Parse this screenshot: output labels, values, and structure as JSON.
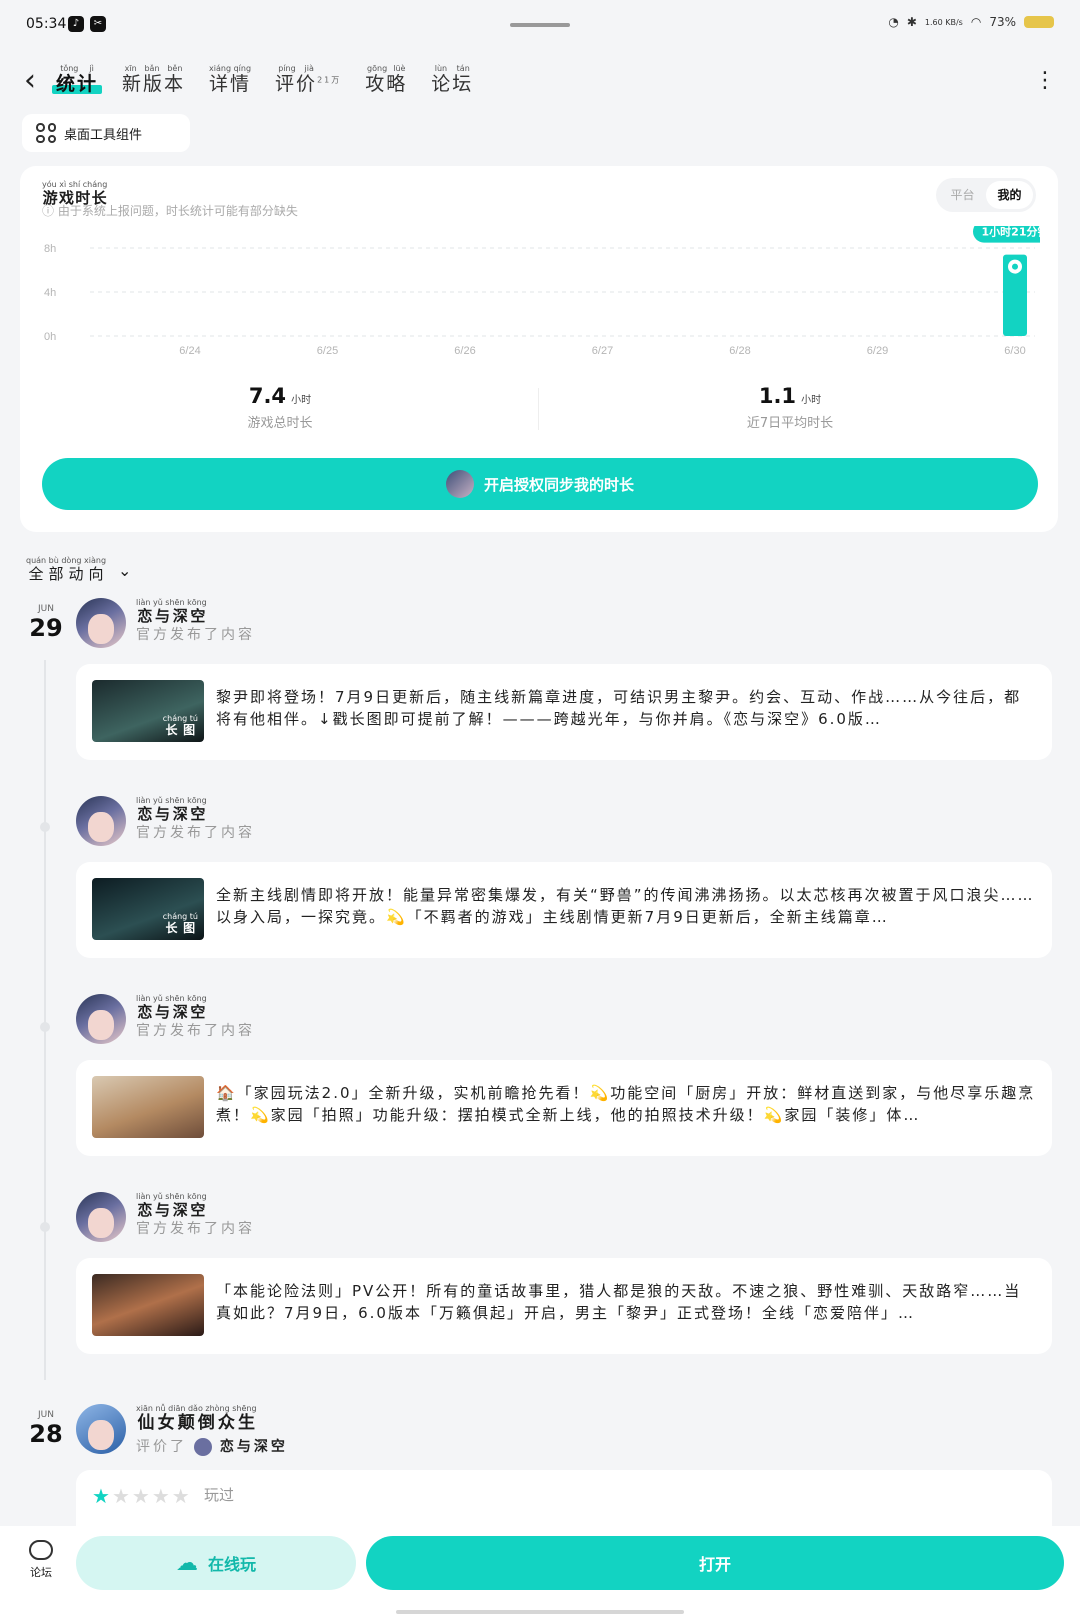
{
  "status": {
    "time": "05:34",
    "battery": "73%",
    "net_speed": "1.60 KB/s"
  },
  "nav": {
    "tabs": [
      {
        "label": "统计",
        "py": [
          "tǒng",
          "jì"
        ],
        "active": true
      },
      {
        "label": "新版本",
        "py": [
          "xīn",
          "bǎn",
          "běn"
        ]
      },
      {
        "label": "详情",
        "py": [
          "xiáng",
          "qíng"
        ]
      },
      {
        "label": "评价",
        "py": [
          "píng",
          "jià"
        ],
        "badge": "21万"
      },
      {
        "label": "攻略",
        "py": [
          "gōng",
          "lüè"
        ]
      },
      {
        "label": "论坛",
        "py": [
          "lùn",
          "tán"
        ]
      }
    ]
  },
  "widget_btn": "桌面工具组件",
  "stats": {
    "title": "游戏时长",
    "note": "由于系统上报问题，时长统计可能有部分缺失",
    "segments": [
      "平台",
      "我的"
    ],
    "active_segment": "我的",
    "tooltip": "1小时21分钟",
    "total_value": "7.4",
    "total_unit": "小时",
    "total_label": "游戏总时长",
    "avg_value": "1.1",
    "avg_unit": "小时",
    "avg_label": "近7日平均时长",
    "sync_btn": "开启授权同步我的时长"
  },
  "chart_data": {
    "type": "bar",
    "categories": [
      "6/24",
      "6/25",
      "6/26",
      "6/27",
      "6/28",
      "6/29",
      "6/30"
    ],
    "values": [
      0,
      0,
      0,
      0,
      0,
      0,
      7.4
    ],
    "yticks": [
      "8h",
      "4h",
      "0h"
    ],
    "ylim": [
      0,
      8
    ],
    "color": "#12d3c2"
  },
  "filter_label": "全部动向",
  "feed": [
    {
      "month": "JUN",
      "day": "29",
      "author": "恋与深空",
      "desc": "官方发布了内容",
      "thumb_tag": "长图",
      "text": "黎尹即将登场！7月9日更新后，随主线新篇章进度，可结识男主黎尹。约会、互动、作战……从今往后，都将有他相伴。↓戳长图即可提前了解！———跨越光年，与你并肩。《恋与深空》6.0版…"
    },
    {
      "author": "恋与深空",
      "desc": "官方发布了内容",
      "thumb_tag": "长图",
      "text": "全新主线剧情即将开放！能量异常密集爆发，有关“野兽”的传闻沸沸扬扬。以太芯核再次被置于风口浪尖……以身入局，一探究竟。💫「不羁者的游戏」主线剧情更新7月9日更新后，全新主线篇章…"
    },
    {
      "author": "恋与深空",
      "desc": "官方发布了内容",
      "text": "🏠「家园玩法2.0」全新升级，实机前瞻抢先看！💫功能空间「厨房」开放：鲜材直送到家，与他尽享乐趣烹煮！💫家园「拍照」功能升级：摆拍模式全新上线，他的拍照技术升级！💫家园「装修」体…"
    },
    {
      "author": "恋与深空",
      "desc": "官方发布了内容",
      "text": "「本能论险法则」PV公开！所有的童话故事里，猎人都是狼的天敌。不速之狼、野性难驯、天敌路窄……当真如此？7月9日，6.0版本「万籁俱起」开启，男主「黎尹」正式登场！全线「恋爱陪伴」…"
    }
  ],
  "review": {
    "month": "JUN",
    "day": "28",
    "author": "仙女颠倒众生",
    "action": "评价了",
    "game": "恋与深空",
    "rating": 1,
    "status": "玩过"
  },
  "bottom": {
    "forum": "论坛",
    "online_btn": "在线玩",
    "open_btn": "打开"
  }
}
